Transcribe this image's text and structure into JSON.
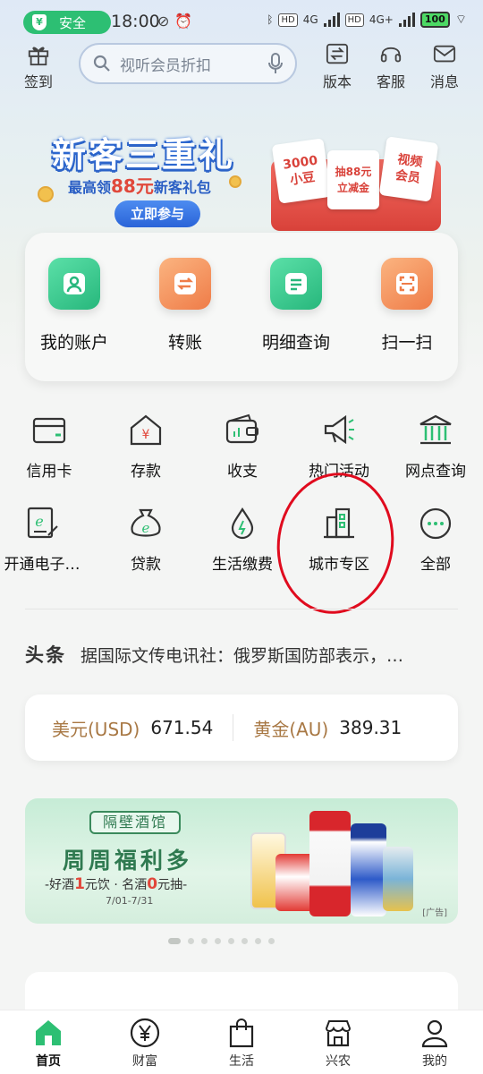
{
  "status_bar": {
    "safe_label": "安全",
    "time": "18:00",
    "network_left": "HD",
    "network_type_1": "4G",
    "network_type_2": "4G+",
    "battery": "100"
  },
  "header": {
    "checkin_label": "签到",
    "search_placeholder": "视听会员折扣",
    "version_label": "版本",
    "service_label": "客服",
    "message_label": "消息"
  },
  "banner": {
    "title": "新客三重礼",
    "sub_prefix": "最高领",
    "sub_amount": "88元",
    "sub_suffix": "新客礼包",
    "cta": "立即参与",
    "cards": [
      "3000\n小豆",
      "抽88元\n立减金",
      "视频\n会员"
    ]
  },
  "quick_actions": [
    {
      "label": "我的账户",
      "icon": "account-icon"
    },
    {
      "label": "转账",
      "icon": "transfer-icon"
    },
    {
      "label": "明细查询",
      "icon": "details-icon"
    },
    {
      "label": "扫一扫",
      "icon": "scan-icon"
    }
  ],
  "grid": [
    {
      "label": "信用卡",
      "icon": "credit-card-icon"
    },
    {
      "label": "存款",
      "icon": "deposit-icon"
    },
    {
      "label": "收支",
      "icon": "wallet-icon"
    },
    {
      "label": "热门活动",
      "icon": "megaphone-icon"
    },
    {
      "label": "网点查询",
      "icon": "bank-icon"
    },
    {
      "label": "开通电子…",
      "icon": "e-account-icon"
    },
    {
      "label": "贷款",
      "icon": "loan-icon"
    },
    {
      "label": "生活缴费",
      "icon": "utility-icon"
    },
    {
      "label": "城市专区",
      "icon": "city-icon"
    },
    {
      "label": "全部",
      "icon": "more-icon"
    }
  ],
  "news": {
    "tag": "头条",
    "text": "据国际文传电讯社：俄罗斯国防部表示，…"
  },
  "rates": [
    {
      "name": "美元(USD)",
      "value": "671.54"
    },
    {
      "name": "黄金(AU)",
      "value": "389.31"
    }
  ],
  "ad": {
    "tag": "隔壁酒馆",
    "title": "周周福利多",
    "sub_1": "-好酒",
    "sub_1_num": "1",
    "sub_2": "元饮 · 名酒",
    "sub_2_num": "0",
    "sub_3": "元抽-",
    "date": "7/01-7/31",
    "ad_mark": "[广告]",
    "slides": 8
  },
  "tabs": [
    {
      "label": "首页",
      "icon": "home-icon",
      "active": true
    },
    {
      "label": "财富",
      "icon": "yen-icon"
    },
    {
      "label": "生活",
      "icon": "shopping-bag-icon"
    },
    {
      "label": "兴农",
      "icon": "store-icon"
    },
    {
      "label": "我的",
      "icon": "person-icon"
    }
  ],
  "colors": {
    "brand_green": "#2dbf73",
    "annotation_red": "#e00b1e",
    "rate_name": "#a87844"
  }
}
